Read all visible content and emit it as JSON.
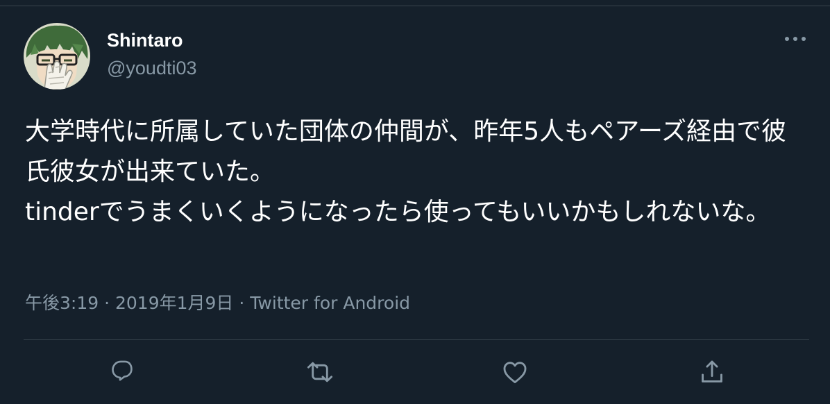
{
  "user": {
    "display_name": "Shintaro",
    "username": "@youdti03"
  },
  "tweet": {
    "text": "大学時代に所属していた団体の仲間が、昨年5人もペアーズ経由で彼氏彼女が出来ていた。\ntinderでうまくいくようになったら使ってもいいかもしれないな。",
    "time": "午後3:19",
    "date": "2019年1月9日",
    "source": "Twitter for Android",
    "separator": "·"
  },
  "icons": {
    "more": "more-horizontal-icon",
    "reply": "reply-icon",
    "retweet": "retweet-icon",
    "like": "like-icon",
    "share": "share-icon"
  },
  "colors": {
    "background": "#15202b",
    "secondary_text": "#8899a6",
    "border": "#38444d"
  }
}
